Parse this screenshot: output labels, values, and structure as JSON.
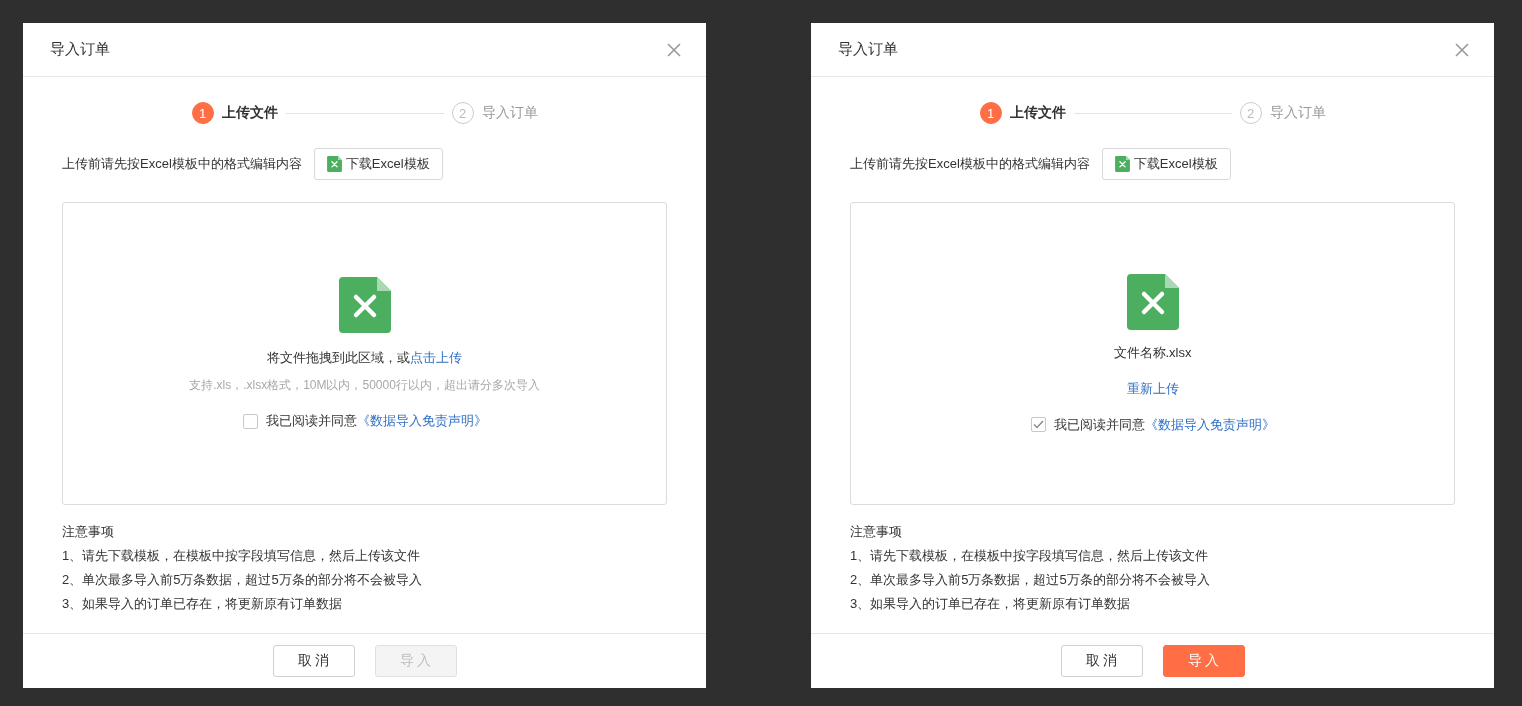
{
  "dialogs": [
    {
      "title": "导入订单",
      "steps": [
        {
          "number": "1",
          "label": "上传文件",
          "active": true
        },
        {
          "number": "2",
          "label": "导入订单",
          "active": false
        }
      ],
      "instruction": "上传前请先按Excel模板中的格式编辑内容",
      "download_button": "下载Excel模板",
      "dropzone": {
        "kind": "empty",
        "prompt": "将文件拖拽到此区域，或",
        "prompt_link": "点击上传",
        "hint": "支持.xls，.xlsx格式，10M以内，50000行以内，超出请分多次导入"
      },
      "agreement": {
        "checked": false,
        "text": "我已阅读并同意",
        "link": "《数据导入免责声明》"
      },
      "notes_title": "注意事项",
      "notes": [
        "1、请先下载模板，在模板中按字段填写信息，然后上传该文件",
        "2、单次最多导入前5万条数据，超过5万条的部分将不会被导入",
        "3、如果导入的订单已存在，将更新原有订单数据"
      ],
      "cancel_button": "取 消",
      "import_button": {
        "label": "导 入",
        "disabled": true
      }
    },
    {
      "title": "导入订单",
      "steps": [
        {
          "number": "1",
          "label": "上传文件",
          "active": true
        },
        {
          "number": "2",
          "label": "导入订单",
          "active": false
        }
      ],
      "instruction": "上传前请先按Excel模板中的格式编辑内容",
      "download_button": "下载Excel模板",
      "dropzone": {
        "kind": "uploaded",
        "file_name": "文件名称.xlsx",
        "reupload_link": "重新上传"
      },
      "agreement": {
        "checked": true,
        "text": "我已阅读并同意",
        "link": "《数据导入免责声明》"
      },
      "notes_title": "注意事项",
      "notes": [
        "1、请先下载模板，在模板中按字段填写信息，然后上传该文件",
        "2、单次最多导入前5万条数据，超过5万条的部分将不会被导入",
        "3、如果导入的订单已存在，将更新原有订单数据"
      ],
      "cancel_button": "取 消",
      "import_button": {
        "label": "导 入",
        "disabled": false
      }
    }
  ]
}
